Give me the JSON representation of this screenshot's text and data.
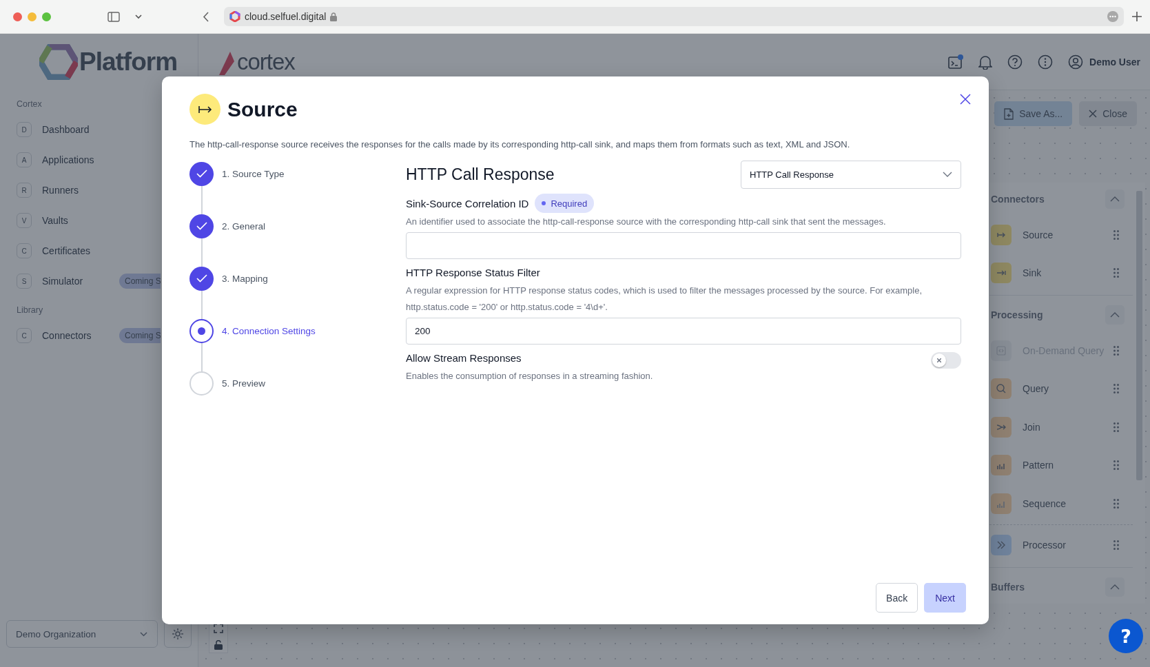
{
  "browser": {
    "url": "cloud.selfuel.digital"
  },
  "sidebar": {
    "logo": "Platform",
    "sections": [
      {
        "title": "Cortex",
        "items": [
          {
            "letter": "D",
            "label": "Dashboard"
          },
          {
            "letter": "A",
            "label": "Applications"
          },
          {
            "letter": "R",
            "label": "Runners"
          },
          {
            "letter": "V",
            "label": "Vaults"
          },
          {
            "letter": "C",
            "label": "Certificates"
          },
          {
            "letter": "S",
            "label": "Simulator",
            "badge": "Coming S"
          }
        ]
      },
      {
        "title": "Library",
        "items": [
          {
            "letter": "C",
            "label": "Connectors",
            "badge": "Coming S"
          }
        ]
      }
    ],
    "organization": "Demo Organization"
  },
  "header": {
    "logo": "cortex",
    "user": "Demo User"
  },
  "toolbar": {
    "buttons": [
      {
        "label": "Save As...",
        "kind": "save"
      },
      {
        "label": "Close",
        "kind": "close"
      }
    ]
  },
  "palette": {
    "sections": [
      {
        "title": "Connectors",
        "expanded": true,
        "groups": [
          [
            {
              "label": "Source",
              "kind": "source",
              "disabled": false
            },
            {
              "label": "Sink",
              "kind": "sink",
              "disabled": false
            }
          ]
        ]
      },
      {
        "title": "Processing",
        "expanded": true,
        "groups": [
          [
            {
              "label": "On-Demand Query",
              "kind": "on-demand-query",
              "disabled": true
            },
            {
              "label": "Query",
              "kind": "query",
              "disabled": false
            },
            {
              "label": "Join",
              "kind": "join",
              "disabled": false
            },
            {
              "label": "Pattern",
              "kind": "pattern",
              "disabled": false
            },
            {
              "label": "Sequence",
              "kind": "sequence",
              "disabled": false
            }
          ],
          [
            {
              "label": "Processor",
              "kind": "processor",
              "disabled": false
            }
          ]
        ]
      },
      {
        "title": "Buffers",
        "expanded": true
      }
    ]
  },
  "modal": {
    "title": "Source",
    "description": "The http-call-response source receives the responses for the calls made by its corresponding http-call sink, and maps them from formats such as text, XML and JSON.",
    "steps": [
      {
        "label": "1. Source Type",
        "completed": true,
        "selected": false
      },
      {
        "label": "2. General",
        "completed": true,
        "selected": false
      },
      {
        "label": "3. Mapping",
        "completed": true,
        "selected": false
      },
      {
        "label": "4. Connection Settings",
        "completed": false,
        "selected": true
      },
      {
        "label": "5. Preview",
        "completed": false,
        "selected": false
      }
    ],
    "form": {
      "heading": "HTTP Call Response",
      "type_select": "HTTP Call Response",
      "fields": [
        {
          "kind": "text",
          "label": "Sink-Source Correlation ID",
          "badge": "Required",
          "description": "An identifier used to associate the http-call-response source with the corresponding http-call sink that sent the messages."
        },
        {
          "kind": "text",
          "label": "HTTP Response Status Filter",
          "description": "A regular expression for HTTP response status codes, which is used to filter the messages processed by the source. For example, http.status.code = '200' or http.status.code = '4\\d+'.",
          "value": "200"
        },
        {
          "kind": "toggle",
          "label": "Allow Stream Responses",
          "description": "Enables the consumption of responses in a streaming fashion.",
          "on": false
        }
      ]
    },
    "buttons": [
      {
        "label": "Back",
        "kind": "secondary"
      },
      {
        "label": "Next",
        "kind": "primary"
      }
    ]
  },
  "help": {
    "label": "?"
  }
}
